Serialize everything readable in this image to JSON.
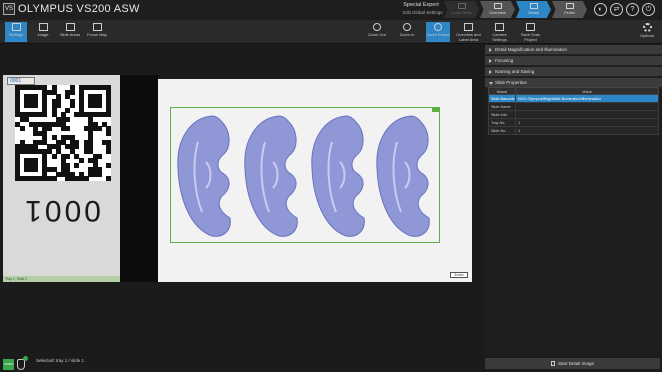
{
  "title_bar": {
    "logo": "VS",
    "app_title": "OLYMPUS VS200 ASW",
    "mode_title": "Special Expert",
    "mode_subtitle": "Edit Global Settings",
    "steps": [
      {
        "label": "Load Slides",
        "state": "dim"
      },
      {
        "label": "Overview",
        "state": "done"
      },
      {
        "label": "Detail",
        "state": "active"
      },
      {
        "label": "Finish",
        "state": "done"
      }
    ],
    "window_icons": [
      "drop-icon",
      "swap-icon",
      "help-icon",
      "power-icon"
    ],
    "window_icon_glyphs": [
      "◐",
      "⇄",
      "?",
      "⏻"
    ]
  },
  "toolbar": {
    "settings": "Settings",
    "image": "Image",
    "slide_areas": "Slide Areas",
    "focus_map": "Focus Map",
    "zoom_out": "Zoom Out",
    "zoom_in": "Zoom In",
    "zoom_extent": "Zoom Extent",
    "overview_label_area": "Overview and Label Area",
    "camera_settings": "Camera Settings",
    "save_scan_project": "Save Scan Project",
    "options": "Options"
  },
  "slide_view": {
    "label_badge": "0001",
    "label_number": "0001",
    "label_footer": "Tray 1, Slide 1",
    "scale_bar": "5 mm"
  },
  "right_panel": {
    "sections": [
      {
        "label": "Detail Magnification and Illumination",
        "open": false
      },
      {
        "label": "Focusing",
        "open": false
      },
      {
        "label": "Naming and Saving",
        "open": false
      },
      {
        "label": "Slide Properties",
        "open": true
      }
    ],
    "table_headers": [
      "Name",
      "Value"
    ],
    "rows": [
      {
        "name": "Slide Barcode",
        "value": "0001 Olympus/Brightfield Illumination/illumination",
        "selected": true
      },
      {
        "name": "Slide Name",
        "value": ""
      },
      {
        "name": "Slide Info",
        "value": ""
      },
      {
        "name": "Tray No.",
        "value": "1"
      },
      {
        "name": "Slide No.",
        "value": "1"
      }
    ],
    "start_button": "Start Detail Image"
  },
  "status_bar": {
    "green_button": "VS200",
    "text": "Selected: tray 1 / slide 1"
  },
  "colors": {
    "accent": "#2d86c5",
    "scan_frame": "#5fae45",
    "tissue_stain": "#8f97d6"
  }
}
